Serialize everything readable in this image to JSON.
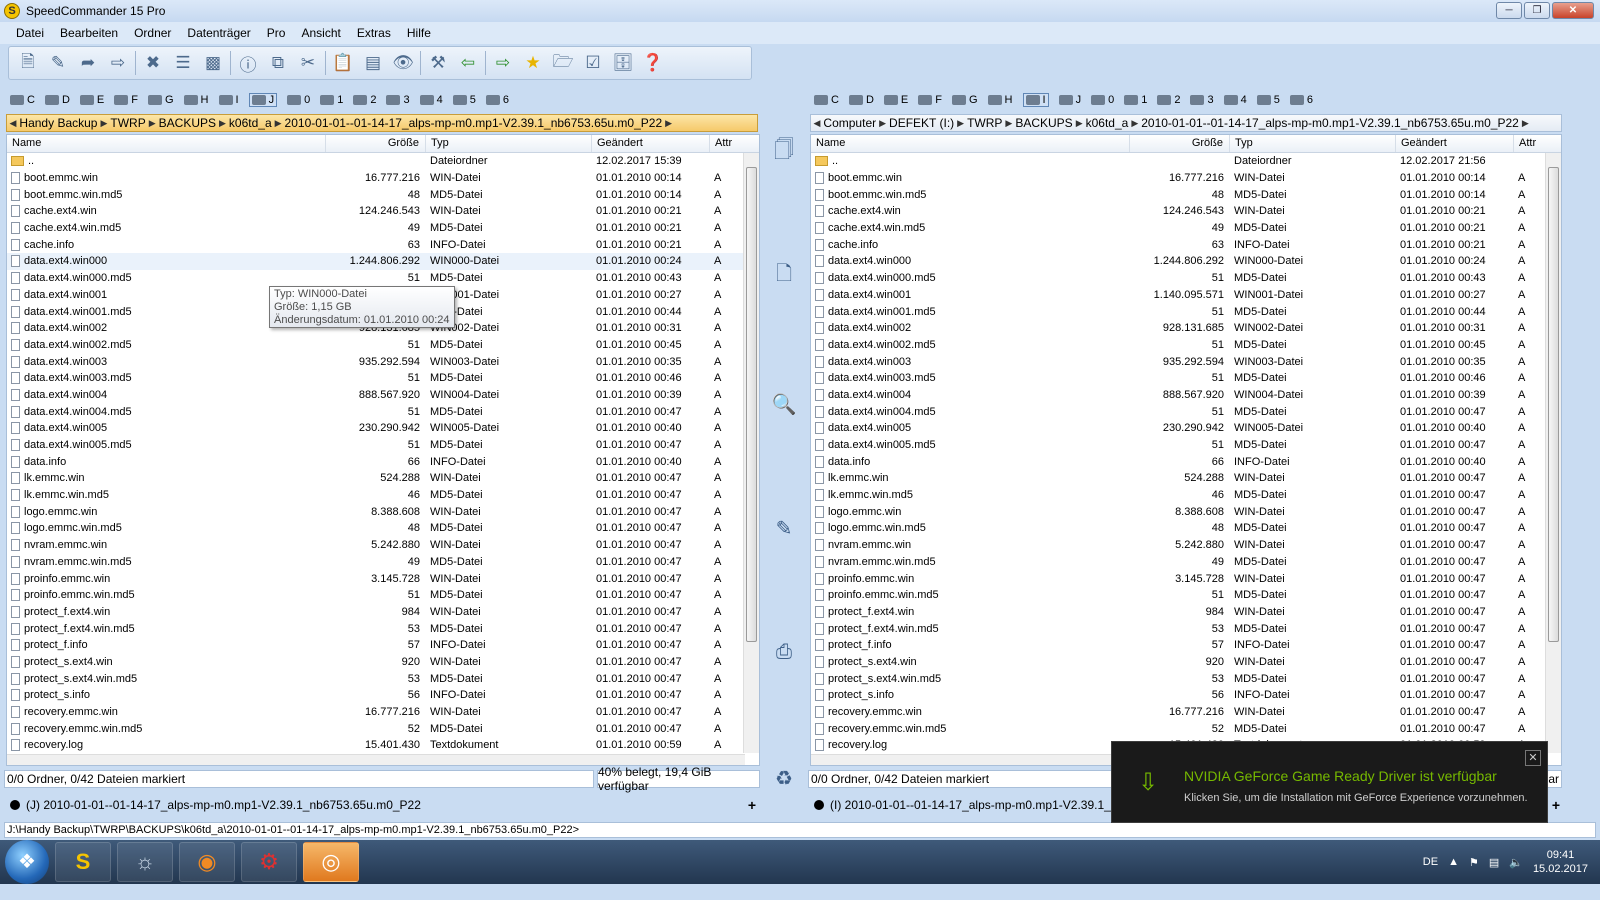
{
  "title": "SpeedCommander 15 Pro",
  "menu": [
    "Datei",
    "Bearbeiten",
    "Ordner",
    "Datenträger",
    "Pro",
    "Ansicht",
    "Extras",
    "Hilfe"
  ],
  "toolbar_icons": [
    "new-file-icon",
    "edit-icon",
    "forward-icon",
    "move-icon",
    "delete-icon",
    "properties-icon",
    "terminal-icon",
    "info-icon",
    "copy-icon",
    "cut-icon",
    "paste-icon",
    "drive-icon",
    "view-icon",
    "tools-icon",
    "back-icon",
    "forward-nav-icon",
    "favorites-icon",
    "folder-sync-icon",
    "checklist-icon",
    "network-drive-icon",
    "help-icon"
  ],
  "left": {
    "drives": [
      "C",
      "D",
      "E",
      "F",
      "G",
      "H",
      "I",
      "J",
      "0",
      "1",
      "2",
      "3",
      "4",
      "5",
      "6"
    ],
    "active_drive": "J",
    "path": [
      "Handy Backup",
      "TWRP",
      "BACKUPS",
      "k06td_a",
      "2010-01-01--01-14-17_alps-mp-m0.mp1-V2.39.1_nb6753.65u.m0_P22"
    ],
    "status_left": "0/0 Ordner, 0/42 Dateien markiert",
    "status_right": "40% belegt, 19,4 GiB verfügbar",
    "tab": "(J) 2010-01-01--01-14-17_alps-mp-m0.mp1-V2.39.1_nb6753.65u.m0_P22"
  },
  "right": {
    "drives": [
      "C",
      "D",
      "E",
      "F",
      "G",
      "H",
      "I",
      "J",
      "0",
      "1",
      "2",
      "3",
      "4",
      "5",
      "6"
    ],
    "active_drive": "I",
    "path": [
      "Computer",
      "DEFEKT (I:)",
      "TWRP",
      "BACKUPS",
      "k06td_a",
      "2010-01-01--01-14-17_alps-mp-m0.mp1-V2.39.1_nb6753.65u.m0_P22"
    ],
    "status_left": "0/0 Ordner, 0/42 Dateien markiert",
    "status_right": "verfügbar",
    "tab": "(I) 2010-01-01--01-14-17_alps-mp-m0.mp1-V2.39.1_nb6753.65u.m0_P22"
  },
  "columns": {
    "name": "Name",
    "size": "Größe",
    "type": "Typ",
    "date": "Geändert",
    "attr": "Attr"
  },
  "left_parent": {
    "name": "..",
    "type": "Dateiordner",
    "date": "12.02.2017  15:39"
  },
  "right_parent": {
    "name": "..",
    "type": "Dateiordner",
    "date": "12.02.2017  21:56"
  },
  "files": [
    {
      "name": "boot.emmc.win",
      "size": "16.777.216",
      "type": "WIN-Datei",
      "date": "01.01.2010  00:14",
      "attr": "A"
    },
    {
      "name": "boot.emmc.win.md5",
      "size": "48",
      "type": "MD5-Datei",
      "date": "01.01.2010  00:14",
      "attr": "A"
    },
    {
      "name": "cache.ext4.win",
      "size": "124.246.543",
      "type": "WIN-Datei",
      "date": "01.01.2010  00:21",
      "attr": "A"
    },
    {
      "name": "cache.ext4.win.md5",
      "size": "49",
      "type": "MD5-Datei",
      "date": "01.01.2010  00:21",
      "attr": "A"
    },
    {
      "name": "cache.info",
      "size": "63",
      "type": "INFO-Datei",
      "date": "01.01.2010  00:21",
      "attr": "A"
    },
    {
      "name": "data.ext4.win000",
      "size": "1.244.806.292",
      "type": "WIN000-Datei",
      "date": "01.01.2010  00:24",
      "attr": "A"
    },
    {
      "name": "data.ext4.win000.md5",
      "size": "51",
      "type": "MD5-Datei",
      "date": "01.01.2010  00:43",
      "attr": "A"
    },
    {
      "name": "data.ext4.win001",
      "size": "1.140.095.571",
      "type": "WIN001-Datei",
      "date": "01.01.2010  00:27",
      "attr": "A"
    },
    {
      "name": "data.ext4.win001.md5",
      "size": "51",
      "type": "MD5-Datei",
      "date": "01.01.2010  00:44",
      "attr": "A"
    },
    {
      "name": "data.ext4.win002",
      "size": "928.131.685",
      "type": "WIN002-Datei",
      "date": "01.01.2010  00:31",
      "attr": "A"
    },
    {
      "name": "data.ext4.win002.md5",
      "size": "51",
      "type": "MD5-Datei",
      "date": "01.01.2010  00:45",
      "attr": "A"
    },
    {
      "name": "data.ext4.win003",
      "size": "935.292.594",
      "type": "WIN003-Datei",
      "date": "01.01.2010  00:35",
      "attr": "A"
    },
    {
      "name": "data.ext4.win003.md5",
      "size": "51",
      "type": "MD5-Datei",
      "date": "01.01.2010  00:46",
      "attr": "A"
    },
    {
      "name": "data.ext4.win004",
      "size": "888.567.920",
      "type": "WIN004-Datei",
      "date": "01.01.2010  00:39",
      "attr": "A"
    },
    {
      "name": "data.ext4.win004.md5",
      "size": "51",
      "type": "MD5-Datei",
      "date": "01.01.2010  00:47",
      "attr": "A"
    },
    {
      "name": "data.ext4.win005",
      "size": "230.290.942",
      "type": "WIN005-Datei",
      "date": "01.01.2010  00:40",
      "attr": "A"
    },
    {
      "name": "data.ext4.win005.md5",
      "size": "51",
      "type": "MD5-Datei",
      "date": "01.01.2010  00:47",
      "attr": "A"
    },
    {
      "name": "data.info",
      "size": "66",
      "type": "INFO-Datei",
      "date": "01.01.2010  00:40",
      "attr": "A"
    },
    {
      "name": "lk.emmc.win",
      "size": "524.288",
      "type": "WIN-Datei",
      "date": "01.01.2010  00:47",
      "attr": "A"
    },
    {
      "name": "lk.emmc.win.md5",
      "size": "46",
      "type": "MD5-Datei",
      "date": "01.01.2010  00:47",
      "attr": "A"
    },
    {
      "name": "logo.emmc.win",
      "size": "8.388.608",
      "type": "WIN-Datei",
      "date": "01.01.2010  00:47",
      "attr": "A"
    },
    {
      "name": "logo.emmc.win.md5",
      "size": "48",
      "type": "MD5-Datei",
      "date": "01.01.2010  00:47",
      "attr": "A"
    },
    {
      "name": "nvram.emmc.win",
      "size": "5.242.880",
      "type": "WIN-Datei",
      "date": "01.01.2010  00:47",
      "attr": "A"
    },
    {
      "name": "nvram.emmc.win.md5",
      "size": "49",
      "type": "MD5-Datei",
      "date": "01.01.2010  00:47",
      "attr": "A"
    },
    {
      "name": "proinfo.emmc.win",
      "size": "3.145.728",
      "type": "WIN-Datei",
      "date": "01.01.2010  00:47",
      "attr": "A"
    },
    {
      "name": "proinfo.emmc.win.md5",
      "size": "51",
      "type": "MD5-Datei",
      "date": "01.01.2010  00:47",
      "attr": "A"
    },
    {
      "name": "protect_f.ext4.win",
      "size": "984",
      "type": "WIN-Datei",
      "date": "01.01.2010  00:47",
      "attr": "A"
    },
    {
      "name": "protect_f.ext4.win.md5",
      "size": "53",
      "type": "MD5-Datei",
      "date": "01.01.2010  00:47",
      "attr": "A"
    },
    {
      "name": "protect_f.info",
      "size": "57",
      "type": "INFO-Datei",
      "date": "01.01.2010  00:47",
      "attr": "A"
    },
    {
      "name": "protect_s.ext4.win",
      "size": "920",
      "type": "WIN-Datei",
      "date": "01.01.2010  00:47",
      "attr": "A"
    },
    {
      "name": "protect_s.ext4.win.md5",
      "size": "53",
      "type": "MD5-Datei",
      "date": "01.01.2010  00:47",
      "attr": "A"
    },
    {
      "name": "protect_s.info",
      "size": "56",
      "type": "INFO-Datei",
      "date": "01.01.2010  00:47",
      "attr": "A"
    },
    {
      "name": "recovery.emmc.win",
      "size": "16.777.216",
      "type": "WIN-Datei",
      "date": "01.01.2010  00:47",
      "attr": "A"
    },
    {
      "name": "recovery.emmc.win.md5",
      "size": "52",
      "type": "MD5-Datei",
      "date": "01.01.2010  00:47",
      "attr": "A"
    },
    {
      "name": "recovery.log",
      "size": "15.401.430",
      "type": "Textdokument",
      "date": "01.01.2010  00:59",
      "attr": "A"
    }
  ],
  "tooltip": [
    "Typ: WIN000-Datei",
    "Größe: 1,15 GB",
    "Änderungsdatum: 01.01.2010 00:24"
  ],
  "cmdline": "J:\\Handy Backup\\TWRP\\BACKUPS\\k06td_a\\2010-01-01--01-14-17_alps-mp-m0.mp1-V2.39.1_nb6753.65u.m0_P22>",
  "notification": {
    "title": "NVIDIA GeForce Game Ready Driver ist verfügbar",
    "body": "Klicken Sie, um die Installation mit GeForce Experience vorzunehmen."
  },
  "tray": {
    "lang": "DE",
    "time": "09:41",
    "date": "15.02.2017"
  }
}
